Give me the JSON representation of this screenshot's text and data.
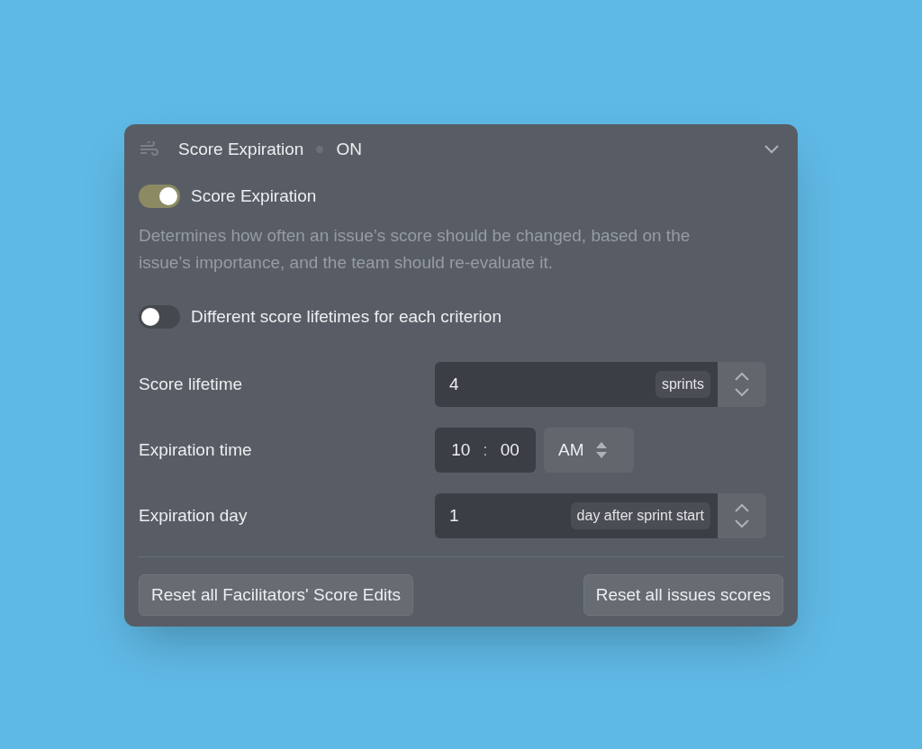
{
  "header": {
    "title": "Score Expiration",
    "status": "ON",
    "expanded": true
  },
  "main_toggle": {
    "label": "Score Expiration",
    "on": true
  },
  "description": "Determines how often an issue’s score should be changed, based on the issue’s importance, and the team should re-evaluate it.",
  "criterion_toggle": {
    "label": "Different score lifetimes for each criterion",
    "on": false
  },
  "fields": [
    {
      "kind": "stepper",
      "label": "Score lifetime",
      "value": "4",
      "unit": "sprints"
    },
    {
      "kind": "time",
      "label": "Expiration time",
      "hours": "10",
      "separator": ":",
      "minutes": "00",
      "period": "AM"
    },
    {
      "kind": "stepper",
      "label": "Expiration day",
      "value": "1",
      "unit": "day after sprint start"
    }
  ],
  "buttons": [
    "Reset all Facilitators' Score Edits",
    "Reset all issues scores"
  ]
}
